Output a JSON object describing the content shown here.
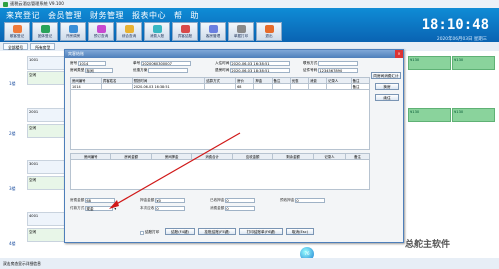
{
  "window_title": "速税云酒店管理系统 V9.100",
  "menu": [
    "来宾登记",
    "会员管理",
    "财务管理",
    "报表中心",
    "帮",
    "助"
  ],
  "toolbar": [
    "散客登记",
    "团体登记",
    "开房调房",
    "预订查询",
    "综合查询",
    "消费入账",
    "宾客结账",
    "客房管理",
    "单据打印",
    "退出"
  ],
  "clock": "18:10:48",
  "date": "2020年06月03日 星期三",
  "tabs": [
    "全部楼号",
    "所有房型"
  ],
  "floors": [
    "1楼",
    "2楼",
    "3楼",
    "4楼"
  ],
  "rooms": [
    "1001",
    "2001",
    "3001",
    "4001"
  ],
  "cell_state": [
    "空闲",
    "空闲",
    "空闲",
    "空闲"
  ],
  "right_price": [
    "¥130",
    "¥130",
    "¥130",
    "¥130"
  ],
  "dialog": {
    "title": "宾客结账",
    "fields": [
      {
        "label": "房号",
        "value": "1014"
      },
      {
        "label": "单号",
        "value": "2020060300007"
      },
      {
        "label": "入住时间",
        "value": "2020-06-03 16:38:51"
      },
      {
        "label": "联系方式",
        "value": ""
      },
      {
        "label": "房间类型",
        "value": "标间"
      },
      {
        "label": "优惠方案",
        "value": ""
      },
      {
        "label": "退房时间",
        "value": "2020-06-03 18:38:51"
      },
      {
        "label": "证件号码",
        "value": "1234567890"
      }
    ],
    "side_buttons": [
      "同房间消费汇计",
      "换房",
      "续住"
    ],
    "table1_headers": [
      "房间编号",
      "宾客姓名",
      "预抵时间",
      "结算方式",
      "房价",
      "押金",
      "备注",
      "优惠",
      "消费",
      "记录人",
      "备注"
    ],
    "table1_row": [
      "1014",
      "",
      "2020-06-03 16:38:51",
      "",
      "68",
      "",
      "",
      "",
      "",
      "",
      "备注"
    ],
    "table2_headers": [
      "房间编号",
      "房间金额",
      "房间押金",
      "消费合计",
      "应收金额",
      "剩余金额",
      "记录人",
      "备注"
    ],
    "summary": [
      {
        "label": "房费金额",
        "value": "68"
      },
      {
        "label": "押金金额",
        "value": "¥0"
      },
      {
        "label": "已收押金",
        "value": "0"
      },
      {
        "label": "预收押金",
        "value": "0"
      },
      {
        "label": "本次应收",
        "value": "0"
      },
      {
        "label": "消费金额",
        "value": "0"
      }
    ],
    "pay_label": "付款方式",
    "pay_value": "现金",
    "checkbox": "结账打印",
    "buttons": [
      "结账(F4键)",
      "挂账结账(F5键)",
      "打印结账单(F6键)",
      "取消(Esc)"
    ]
  },
  "status": "双击房态显示详细信息",
  "orb": "76",
  "watermark": "总舵主软件"
}
